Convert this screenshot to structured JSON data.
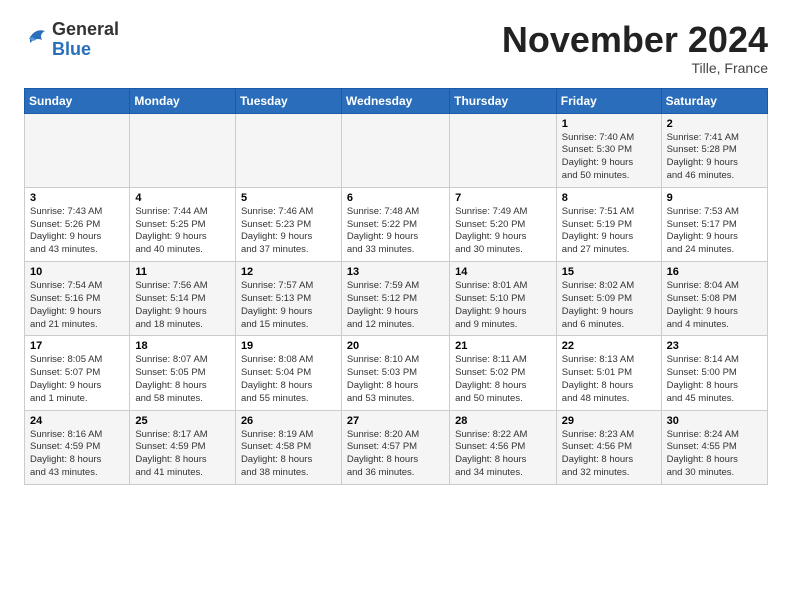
{
  "header": {
    "logo_general": "General",
    "logo_blue": "Blue",
    "month_title": "November 2024",
    "location": "Tille, France"
  },
  "weekdays": [
    "Sunday",
    "Monday",
    "Tuesday",
    "Wednesday",
    "Thursday",
    "Friday",
    "Saturday"
  ],
  "weeks": [
    [
      {
        "day": "",
        "info": ""
      },
      {
        "day": "",
        "info": ""
      },
      {
        "day": "",
        "info": ""
      },
      {
        "day": "",
        "info": ""
      },
      {
        "day": "",
        "info": ""
      },
      {
        "day": "1",
        "info": "Sunrise: 7:40 AM\nSunset: 5:30 PM\nDaylight: 9 hours\nand 50 minutes."
      },
      {
        "day": "2",
        "info": "Sunrise: 7:41 AM\nSunset: 5:28 PM\nDaylight: 9 hours\nand 46 minutes."
      }
    ],
    [
      {
        "day": "3",
        "info": "Sunrise: 7:43 AM\nSunset: 5:26 PM\nDaylight: 9 hours\nand 43 minutes."
      },
      {
        "day": "4",
        "info": "Sunrise: 7:44 AM\nSunset: 5:25 PM\nDaylight: 9 hours\nand 40 minutes."
      },
      {
        "day": "5",
        "info": "Sunrise: 7:46 AM\nSunset: 5:23 PM\nDaylight: 9 hours\nand 37 minutes."
      },
      {
        "day": "6",
        "info": "Sunrise: 7:48 AM\nSunset: 5:22 PM\nDaylight: 9 hours\nand 33 minutes."
      },
      {
        "day": "7",
        "info": "Sunrise: 7:49 AM\nSunset: 5:20 PM\nDaylight: 9 hours\nand 30 minutes."
      },
      {
        "day": "8",
        "info": "Sunrise: 7:51 AM\nSunset: 5:19 PM\nDaylight: 9 hours\nand 27 minutes."
      },
      {
        "day": "9",
        "info": "Sunrise: 7:53 AM\nSunset: 5:17 PM\nDaylight: 9 hours\nand 24 minutes."
      }
    ],
    [
      {
        "day": "10",
        "info": "Sunrise: 7:54 AM\nSunset: 5:16 PM\nDaylight: 9 hours\nand 21 minutes."
      },
      {
        "day": "11",
        "info": "Sunrise: 7:56 AM\nSunset: 5:14 PM\nDaylight: 9 hours\nand 18 minutes."
      },
      {
        "day": "12",
        "info": "Sunrise: 7:57 AM\nSunset: 5:13 PM\nDaylight: 9 hours\nand 15 minutes."
      },
      {
        "day": "13",
        "info": "Sunrise: 7:59 AM\nSunset: 5:12 PM\nDaylight: 9 hours\nand 12 minutes."
      },
      {
        "day": "14",
        "info": "Sunrise: 8:01 AM\nSunset: 5:10 PM\nDaylight: 9 hours\nand 9 minutes."
      },
      {
        "day": "15",
        "info": "Sunrise: 8:02 AM\nSunset: 5:09 PM\nDaylight: 9 hours\nand 6 minutes."
      },
      {
        "day": "16",
        "info": "Sunrise: 8:04 AM\nSunset: 5:08 PM\nDaylight: 9 hours\nand 4 minutes."
      }
    ],
    [
      {
        "day": "17",
        "info": "Sunrise: 8:05 AM\nSunset: 5:07 PM\nDaylight: 9 hours\nand 1 minute."
      },
      {
        "day": "18",
        "info": "Sunrise: 8:07 AM\nSunset: 5:05 PM\nDaylight: 8 hours\nand 58 minutes."
      },
      {
        "day": "19",
        "info": "Sunrise: 8:08 AM\nSunset: 5:04 PM\nDaylight: 8 hours\nand 55 minutes."
      },
      {
        "day": "20",
        "info": "Sunrise: 8:10 AM\nSunset: 5:03 PM\nDaylight: 8 hours\nand 53 minutes."
      },
      {
        "day": "21",
        "info": "Sunrise: 8:11 AM\nSunset: 5:02 PM\nDaylight: 8 hours\nand 50 minutes."
      },
      {
        "day": "22",
        "info": "Sunrise: 8:13 AM\nSunset: 5:01 PM\nDaylight: 8 hours\nand 48 minutes."
      },
      {
        "day": "23",
        "info": "Sunrise: 8:14 AM\nSunset: 5:00 PM\nDaylight: 8 hours\nand 45 minutes."
      }
    ],
    [
      {
        "day": "24",
        "info": "Sunrise: 8:16 AM\nSunset: 4:59 PM\nDaylight: 8 hours\nand 43 minutes."
      },
      {
        "day": "25",
        "info": "Sunrise: 8:17 AM\nSunset: 4:59 PM\nDaylight: 8 hours\nand 41 minutes."
      },
      {
        "day": "26",
        "info": "Sunrise: 8:19 AM\nSunset: 4:58 PM\nDaylight: 8 hours\nand 38 minutes."
      },
      {
        "day": "27",
        "info": "Sunrise: 8:20 AM\nSunset: 4:57 PM\nDaylight: 8 hours\nand 36 minutes."
      },
      {
        "day": "28",
        "info": "Sunrise: 8:22 AM\nSunset: 4:56 PM\nDaylight: 8 hours\nand 34 minutes."
      },
      {
        "day": "29",
        "info": "Sunrise: 8:23 AM\nSunset: 4:56 PM\nDaylight: 8 hours\nand 32 minutes."
      },
      {
        "day": "30",
        "info": "Sunrise: 8:24 AM\nSunset: 4:55 PM\nDaylight: 8 hours\nand 30 minutes."
      }
    ]
  ]
}
